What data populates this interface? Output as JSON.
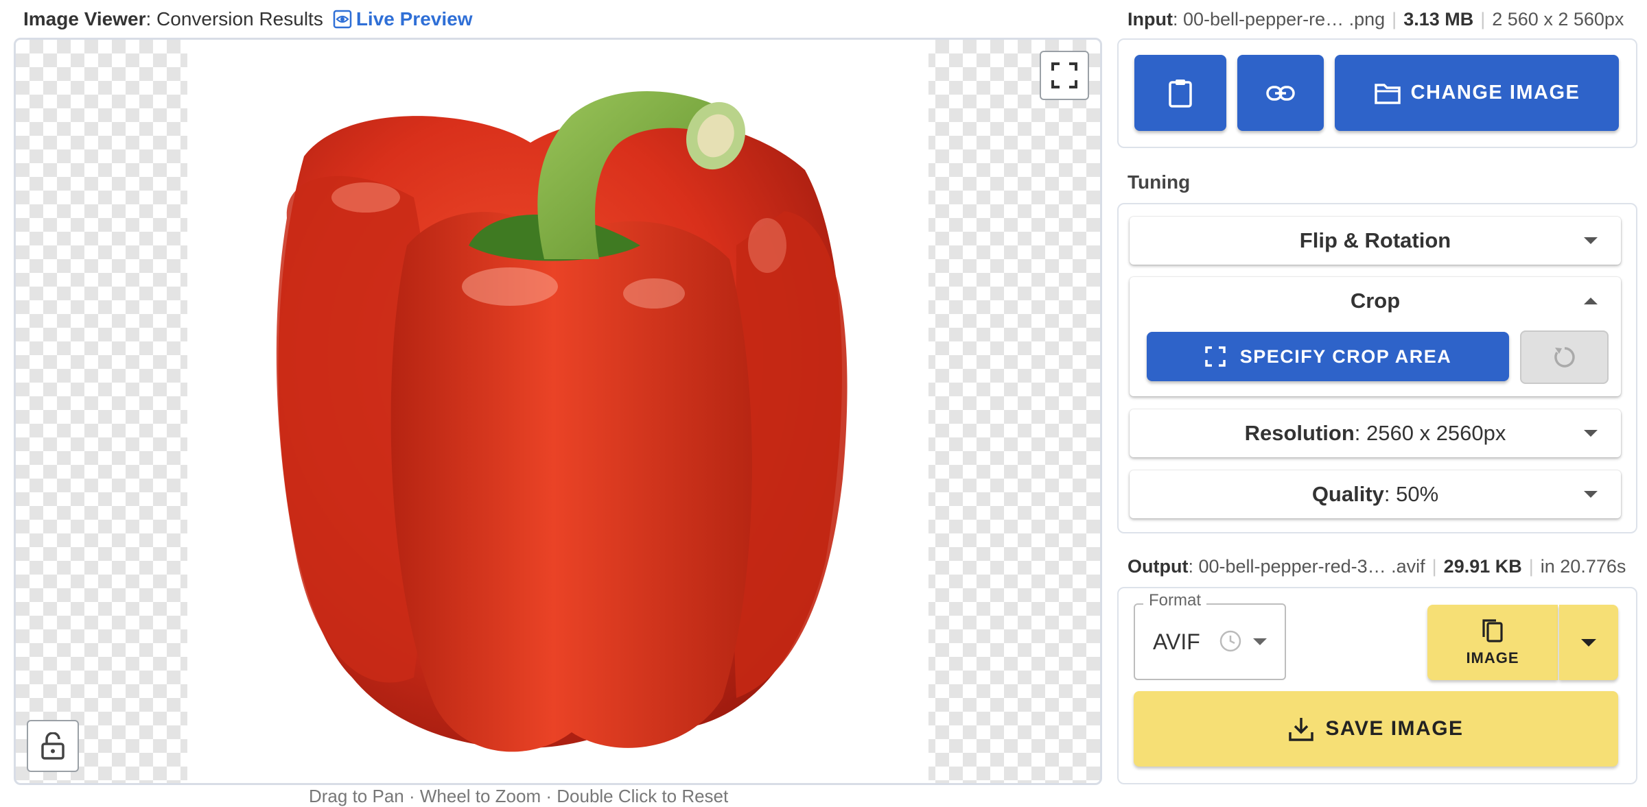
{
  "viewer": {
    "title": "Image Viewer",
    "subtitle": "Conversion Results",
    "live_preview": "Live Preview",
    "hint_text": "Drag to Pan · Wheel to Zoom · Double Click to Reset"
  },
  "input": {
    "label": "Input",
    "filename": "00-bell-pepper-re… .png",
    "size": "3.13 MB",
    "dimensions": "2 560 x 2 560px"
  },
  "toolbar": {
    "change_image": "CHANGE IMAGE",
    "paste_icon": "clipboard-icon",
    "link_icon": "link-icon",
    "folder_icon": "folder-icon"
  },
  "tuning": {
    "label": "Tuning",
    "flip_rotation": "Flip & Rotation",
    "crop": "Crop",
    "specify_crop": "SPECIFY CROP AREA",
    "resolution_label": "Resolution",
    "resolution_value": "2560 x 2560px",
    "quality_label": "Quality",
    "quality_value": "50%"
  },
  "output": {
    "label": "Output",
    "filename": "00-bell-pepper-red-3… .avif",
    "size": "29.91 KB",
    "time": "in 20.776s"
  },
  "format": {
    "label": "Format",
    "value": "AVIF"
  },
  "actions": {
    "copy_image": "IMAGE",
    "save_image": "SAVE IMAGE"
  },
  "colors": {
    "primary_blue": "#2e63c9",
    "accent_yellow": "#f6df75",
    "link_blue": "#2f6fd6"
  }
}
